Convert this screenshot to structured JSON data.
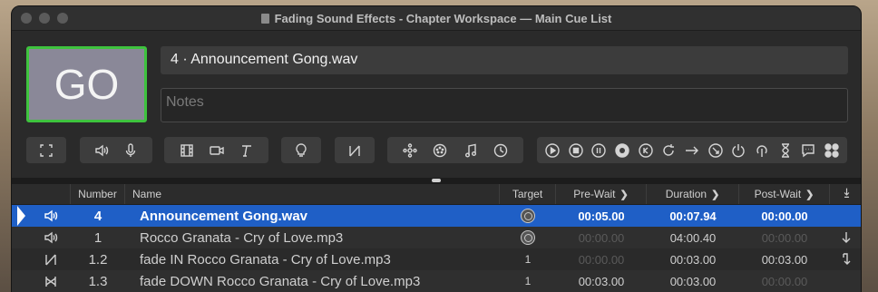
{
  "window": {
    "title": "Fading Sound Effects - Chapter Workspace — Main Cue List"
  },
  "go_button": {
    "label": "GO"
  },
  "cue_name": {
    "value": "4 · Announcement Gong.wav"
  },
  "notes": {
    "placeholder": "Notes"
  },
  "toolbar": {
    "groups": [
      {
        "icons": [
          "fullscreen-icon"
        ]
      },
      {
        "icons": [
          "audio-cue-icon",
          "mic-cue-icon"
        ]
      },
      {
        "icons": [
          "video-cue-icon",
          "camera-cue-icon",
          "text-cue-icon"
        ]
      },
      {
        "icons": [
          "light-cue-icon"
        ]
      },
      {
        "icons": [
          "fade-cue-icon"
        ]
      },
      {
        "icons": [
          "network-cue-icon",
          "midi-cue-icon",
          "music-cue-icon",
          "timecode-cue-icon"
        ]
      },
      {
        "icons": [
          "start-icon",
          "stop-icon",
          "pause-icon",
          "load-icon",
          "reset-icon",
          "devamp-icon",
          "goto-icon",
          "target-icon",
          "arm-icon",
          "disarm-icon",
          "wait-icon",
          "memo-icon",
          "script-icon"
        ]
      }
    ]
  },
  "table": {
    "headers": {
      "number": "Number",
      "name": "Name",
      "target": "Target",
      "pre_wait": "Pre-Wait",
      "duration": "Duration",
      "post_wait": "Post-Wait"
    },
    "rows": [
      {
        "type_icon": "audio-icon",
        "number": "4",
        "name": "Announcement Gong.wav",
        "target": "",
        "pre_wait": "00:05.00",
        "duration": "00:07.94",
        "post_wait": "00:00.00",
        "continue_icon": ""
      },
      {
        "type_icon": "audio-icon",
        "number": "1",
        "name": "Rocco Granata - Cry of Love.mp3",
        "target": "",
        "pre_wait": "00:00.00",
        "duration": "04:00.40",
        "post_wait": "00:00.00",
        "continue_icon": "auto-continue-icon"
      },
      {
        "type_icon": "fade-icon",
        "number": "1.2",
        "name": "fade IN Rocco Granata - Cry of Love.mp3",
        "target": "1",
        "pre_wait": "00:00.00",
        "duration": "00:03.00",
        "post_wait": "00:03.00",
        "continue_icon": "auto-follow-icon"
      },
      {
        "type_icon": "fade-icon",
        "number": "1.3",
        "name": "fade DOWN Rocco Granata - Cry of Love.mp3",
        "target": "1",
        "pre_wait": "00:03.00",
        "duration": "00:03.00",
        "post_wait": "00:00.00",
        "continue_icon": ""
      }
    ]
  },
  "colors": {
    "go_border": "#3ec33e",
    "selected_row": "#1f5fc6"
  }
}
